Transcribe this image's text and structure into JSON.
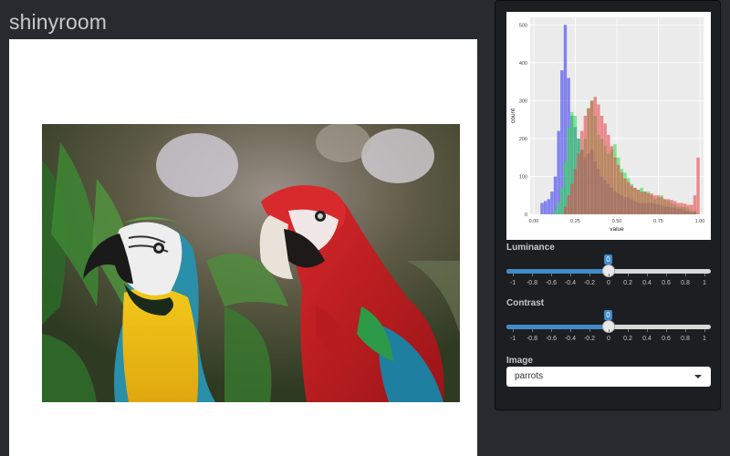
{
  "app": {
    "title": "shinyroom"
  },
  "image_panel": {
    "image_label": "parrots"
  },
  "controls": {
    "luminance": {
      "label": "Luminance",
      "value": 0,
      "min": -1,
      "max": 1,
      "ticks": [
        "-1",
        "-0.8",
        "-0.6",
        "-0.4",
        "-0.2",
        "0",
        "0.2",
        "0.4",
        "0.6",
        "0.8",
        "1"
      ]
    },
    "contrast": {
      "label": "Contrast",
      "value": 0,
      "min": -1,
      "max": 1,
      "ticks": [
        "-1",
        "-0.8",
        "-0.6",
        "-0.4",
        "-0.2",
        "0",
        "0.2",
        "0.4",
        "0.6",
        "0.8",
        "1"
      ]
    },
    "image_select": {
      "label": "Image",
      "selected": "parrots"
    }
  },
  "colors": {
    "accent": "#428bca",
    "red_channel": "#e8474b",
    "green_channel": "#2fe04a",
    "blue_channel": "#3c3cf0"
  },
  "chart_data": {
    "type": "bar",
    "xlabel": "value",
    "ylabel": "count",
    "xlim": [
      0,
      1
    ],
    "ylim": [
      0,
      520
    ],
    "x_ticks": [
      "0.00",
      "0.25",
      "0.50",
      "0.75",
      "1.00"
    ],
    "y_ticks": [
      "0",
      "100",
      "200",
      "300",
      "400",
      "500"
    ],
    "bins": [
      0.0,
      0.02,
      0.04,
      0.06,
      0.08,
      0.1,
      0.12,
      0.14,
      0.16,
      0.18,
      0.2,
      0.22,
      0.24,
      0.26,
      0.28,
      0.3,
      0.32,
      0.34,
      0.36,
      0.38,
      0.4,
      0.42,
      0.44,
      0.46,
      0.48,
      0.5,
      0.52,
      0.54,
      0.56,
      0.58,
      0.6,
      0.62,
      0.64,
      0.66,
      0.68,
      0.7,
      0.72,
      0.74,
      0.76,
      0.78,
      0.8,
      0.82,
      0.84,
      0.86,
      0.88,
      0.9,
      0.92,
      0.94,
      0.96,
      0.98
    ],
    "series": [
      {
        "color": "#3c3cf0",
        "values": [
          0,
          0,
          30,
          35,
          40,
          60,
          100,
          220,
          380,
          500,
          360,
          260,
          230,
          200,
          170,
          150,
          160,
          170,
          140,
          120,
          100,
          90,
          80,
          70,
          60,
          55,
          50,
          45,
          45,
          40,
          35,
          30,
          30,
          30,
          30,
          30,
          28,
          25,
          25,
          20,
          20,
          18,
          18,
          15,
          15,
          10,
          8,
          5,
          5,
          0
        ]
      },
      {
        "color": "#2fe04a",
        "values": [
          0,
          0,
          0,
          0,
          0,
          0,
          10,
          30,
          70,
          140,
          230,
          270,
          260,
          200,
          170,
          200,
          280,
          300,
          260,
          210,
          200,
          180,
          160,
          170,
          185,
          150,
          120,
          110,
          95,
          80,
          70,
          65,
          70,
          60,
          60,
          50,
          40,
          45,
          50,
          40,
          35,
          30,
          25,
          20,
          20,
          20,
          15,
          10,
          10,
          0
        ]
      },
      {
        "color": "#e8474b",
        "values": [
          0,
          0,
          0,
          0,
          0,
          0,
          0,
          0,
          0,
          20,
          50,
          80,
          120,
          160,
          220,
          260,
          280,
          300,
          310,
          290,
          260,
          240,
          210,
          180,
          150,
          130,
          110,
          95,
          85,
          75,
          70,
          65,
          60,
          60,
          55,
          55,
          50,
          50,
          45,
          40,
          40,
          38,
          35,
          30,
          30,
          28,
          25,
          25,
          50,
          150
        ]
      }
    ]
  }
}
